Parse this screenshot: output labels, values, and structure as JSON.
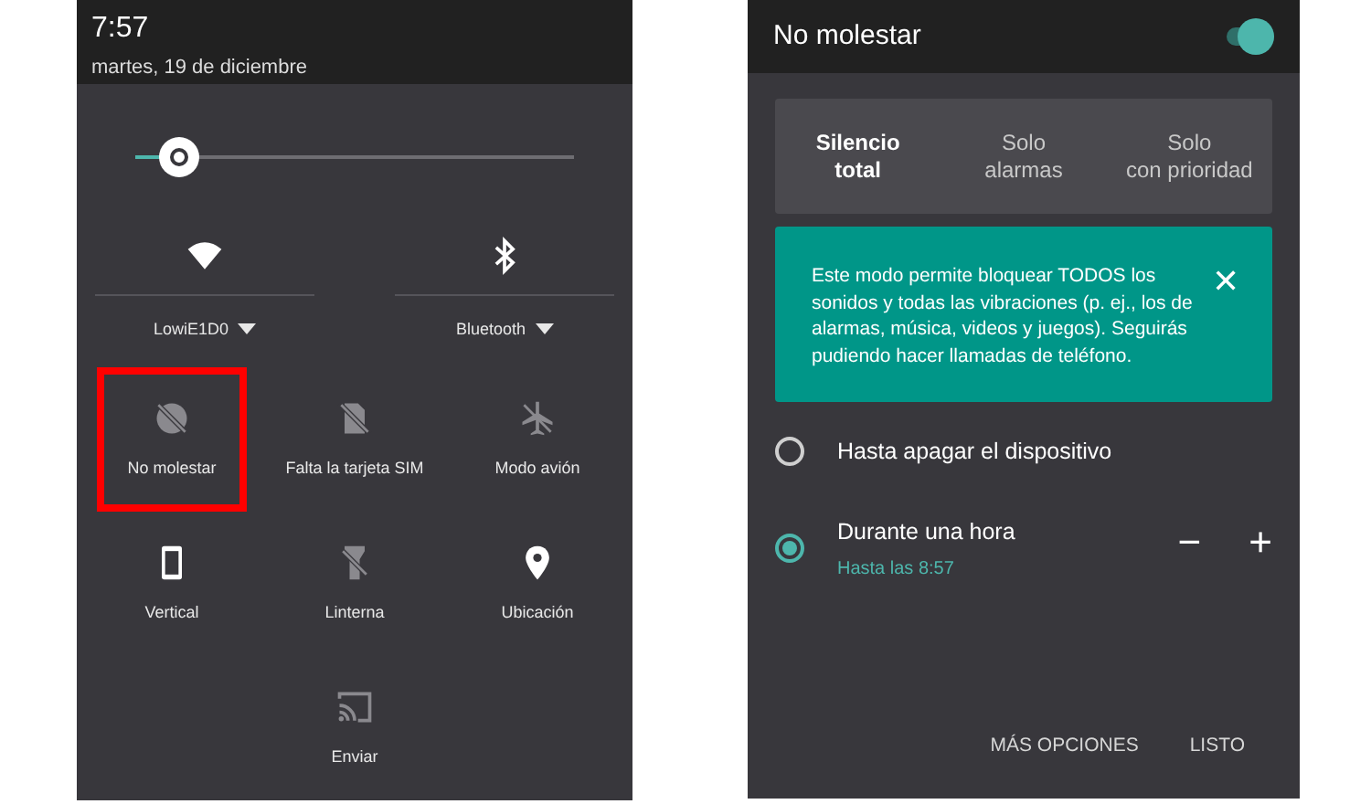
{
  "quick_settings": {
    "time": "7:57",
    "date": "martes, 19 de diciembre",
    "brightness": {
      "level": 0.1
    },
    "connections": [
      {
        "kind": "wifi",
        "label": "LowiE1D0",
        "on": true
      },
      {
        "kind": "bluetooth",
        "label": "Bluetooth",
        "on": true
      }
    ],
    "tiles": [
      {
        "kind": "dnd",
        "label": "No molestar",
        "on": false,
        "highlighted": true
      },
      {
        "kind": "sim",
        "label": "Falta la tarjeta SIM",
        "on": false,
        "highlighted": false
      },
      {
        "kind": "airplane",
        "label": "Modo avión",
        "on": false,
        "highlighted": false
      },
      {
        "kind": "phone",
        "label": "Vertical",
        "on": true,
        "highlighted": false
      },
      {
        "kind": "flashlight",
        "label": "Linterna",
        "on": false,
        "highlighted": false
      },
      {
        "kind": "location",
        "label": "Ubicación",
        "on": true,
        "highlighted": false
      },
      {
        "kind": "cast",
        "label": "Enviar",
        "on": false,
        "highlighted": false
      }
    ]
  },
  "do_not_disturb": {
    "title": "No molestar",
    "on": true,
    "modes": [
      {
        "line1": "Silencio",
        "line2": "total",
        "selected": true
      },
      {
        "line1": "Solo",
        "line2": "alarmas",
        "selected": false
      },
      {
        "line1": "Solo",
        "line2": "con prioridad",
        "selected": false
      }
    ],
    "info": "Este modo permite bloquear TODOS los sonidos y todas las vibraciones (p. ej., los de alarmas, música, videos y juegos). Seguirás pudiendo hacer llamadas de teléfono.",
    "info_close": "✕",
    "durations": [
      {
        "label": "Hasta apagar el dispositivo",
        "selected": false
      },
      {
        "label": "Durante una hora",
        "sublabel": "Hasta las 8:57",
        "selected": true,
        "decrease": "−",
        "increase": "+"
      }
    ],
    "buttons": [
      "MÁS OPCIONES",
      "LISTO"
    ]
  }
}
